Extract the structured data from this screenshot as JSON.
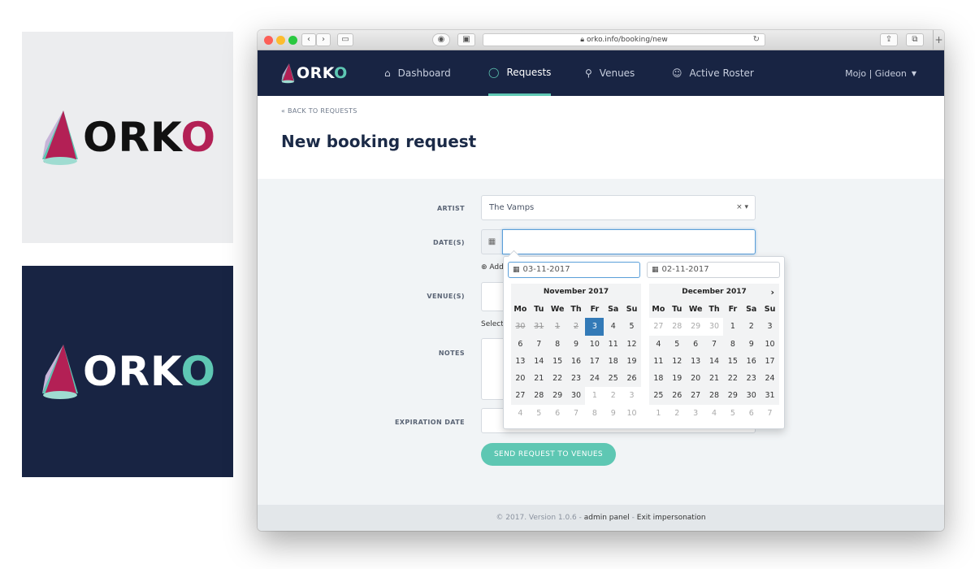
{
  "logo_text": [
    "ORK",
    "O"
  ],
  "browser": {
    "url": "orko.info/booking/new"
  },
  "nav": {
    "brand": [
      "ORK",
      "O"
    ],
    "items": [
      {
        "label": "Dashboard",
        "icon": "home-icon"
      },
      {
        "label": "Requests",
        "icon": "chat-bubble-icon"
      },
      {
        "label": "Venues",
        "icon": "map-pin-icon"
      },
      {
        "label": "Active Roster",
        "icon": "user-icon"
      }
    ],
    "user": "Mojo | Gideon"
  },
  "page": {
    "back_link": "« BACK TO REQUESTS",
    "title": "New booking request"
  },
  "form": {
    "labels": {
      "artist": "ARTIST",
      "dates": "DATE(S)",
      "venues": "VENUE(S)",
      "notes": "NOTES",
      "expiration": "EXPIRATION DATE"
    },
    "artist_value": "The Vamps",
    "artist_clear": "×",
    "add_link": "Add",
    "select_hint": "Select",
    "send_button": "SEND REQUEST TO VENUES"
  },
  "datepicker": {
    "start_input": "03-11-2017",
    "end_input": "02-11-2017",
    "left_month": "November 2017",
    "right_month": "December 2017",
    "weekdays": [
      "Mo",
      "Tu",
      "We",
      "Th",
      "Fr",
      "Sa",
      "Su"
    ],
    "left_days": [
      "30",
      "31",
      "1",
      "2",
      "3",
      "4",
      "5",
      "6",
      "7",
      "8",
      "9",
      "10",
      "11",
      "12",
      "13",
      "14",
      "15",
      "16",
      "17",
      "18",
      "19",
      "20",
      "21",
      "22",
      "23",
      "24",
      "25",
      "26",
      "27",
      "28",
      "29",
      "30",
      "1",
      "2",
      "3",
      "4",
      "5",
      "6",
      "7",
      "8",
      "9",
      "10"
    ],
    "right_days": [
      "27",
      "28",
      "29",
      "30",
      "1",
      "2",
      "3",
      "4",
      "5",
      "6",
      "7",
      "8",
      "9",
      "10",
      "11",
      "12",
      "13",
      "14",
      "15",
      "16",
      "17",
      "18",
      "19",
      "20",
      "21",
      "22",
      "23",
      "24",
      "25",
      "26",
      "27",
      "28",
      "29",
      "30",
      "31",
      "1",
      "2",
      "3",
      "4",
      "5",
      "6",
      "7"
    ],
    "left_selected_index": 4,
    "left_past_count": 4,
    "left_current_month_range": [
      2,
      31
    ],
    "right_current_month_range": [
      4,
      34
    ],
    "selected_color": "#337ab7"
  },
  "footer": {
    "prefix": "© 2017. Version 1.0.6 - ",
    "admin_link": "admin panel",
    "sep": " - ",
    "exit_link": "Exit impersonation"
  },
  "colors": {
    "navy": "#182443",
    "teal": "#5ec7b3",
    "crimson": "#b32055"
  }
}
